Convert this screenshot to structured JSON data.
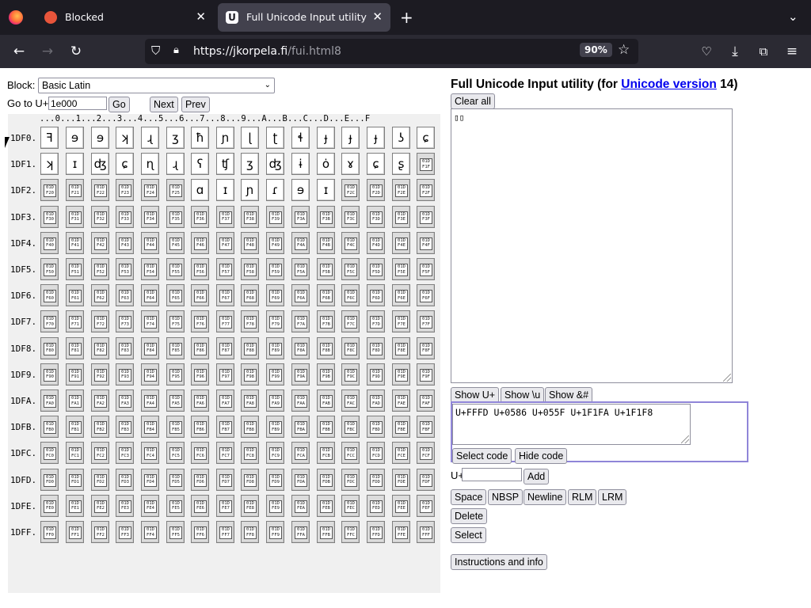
{
  "browser": {
    "tabs": [
      {
        "title": "Blocked",
        "active": false
      },
      {
        "title": "Full Unicode Input utility",
        "active": true
      }
    ],
    "url_host": "https://jkorpela.fi",
    "url_path": "/fui.html8",
    "zoom": "90%"
  },
  "page": {
    "block_label": "Block:",
    "block_value": "Basic Latin",
    "goto_label": "Go to U+",
    "goto_value": "1e000",
    "go_button": "Go",
    "next_button": "Next",
    "prev_button": "Prev",
    "column_header": "...0...1...2...3...4...5...6...7...8...9...A...B...C...D...E...F",
    "rows": [
      "1DF0.",
      "1DF1.",
      "1DF2.",
      "1DF3.",
      "1DF4.",
      "1DF5.",
      "1DF6.",
      "1DF7.",
      "1DF8.",
      "1DF9.",
      "1DFA.",
      "1DFB.",
      "1DFC.",
      "1DFD.",
      "1DFE.",
      "1DFF."
    ],
    "glyph_rows": [
      [
        "ꟻ",
        "ɘ",
        "ɘ",
        "ʞ",
        "ɻ",
        "ʒ",
        "ħ",
        "ɲ",
        "ɭ",
        "ʈ",
        "ɬ",
        "ɟ",
        "ɟ",
        "ɟ",
        "ʖ",
        "ɕ"
      ],
      [
        "ʞ",
        "ɪ",
        "ʤ",
        "ɕ",
        "ɳ",
        "ɻ",
        "ʕ",
        "ʧ",
        "ʒ",
        "ʤ",
        "ɨ",
        "ȯ",
        "ɤ",
        "ɕ",
        "ʂ",
        ""
      ],
      [
        "",
        "",
        "",
        "",
        "",
        "",
        "ɑ",
        "ɪ",
        "ɲ",
        "ɾ",
        "ɘ",
        "ɪ",
        "",
        "",
        "",
        ""
      ]
    ],
    "title_prefix": "Full Unicode Input utility (for ",
    "title_link": "Unicode version",
    "title_suffix": " 14)",
    "clear_all": "Clear all",
    "output_text": "▯▯",
    "show_uplus": "Show U+",
    "show_u": "Show \\u",
    "show_amp": "Show &#",
    "code_text": "U+FFFD U+0586 U+055F U+1F1FA U+1F1F8",
    "select_code": "Select code",
    "hide_code": "Hide code",
    "uplus_label": "U+",
    "add_button": "Add",
    "space": "Space",
    "nbsp": "NBSP",
    "newline": "Newline",
    "rlm": "RLM",
    "lrm": "LRM",
    "delete": "Delete",
    "select": "Select",
    "instructions": "Instructions and info"
  }
}
